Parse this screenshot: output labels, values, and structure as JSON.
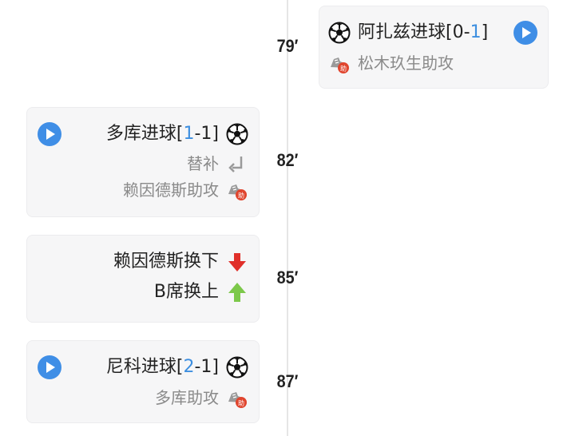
{
  "events": [
    {
      "minute": "79′",
      "goal_text": "阿扎兹进球",
      "score_open": "[",
      "score_home": "0",
      "score_sep": "-",
      "score_away": "1",
      "score_close": "]",
      "assist": "松木玖生助攻"
    },
    {
      "minute": "82′",
      "goal_text": "多库进球",
      "score_open": "[",
      "score_home": "1",
      "score_sep": "-",
      "score_away": "1",
      "score_close": "]",
      "sub_label": "替补",
      "assist": "赖因德斯助攻"
    },
    {
      "minute": "85′",
      "sub_off": "赖因德斯换下",
      "sub_on": "B席换上"
    },
    {
      "minute": "87′",
      "goal_text": "尼科进球",
      "score_open": "[",
      "score_home": "2",
      "score_sep": "-",
      "score_away": "1",
      "score_close": "]",
      "assist": "多库助攻"
    }
  ],
  "assist_badge": "助",
  "colors": {
    "accent": "#3f8ee6",
    "score_highlight": "#3d8fe0",
    "down_arrow": "#e0302a",
    "up_arrow": "#7cc84a"
  },
  "icons": [
    "play-icon",
    "soccer-ball-icon",
    "assist-boot-icon",
    "substitution-return-icon",
    "arrow-down-icon",
    "arrow-up-icon"
  ]
}
